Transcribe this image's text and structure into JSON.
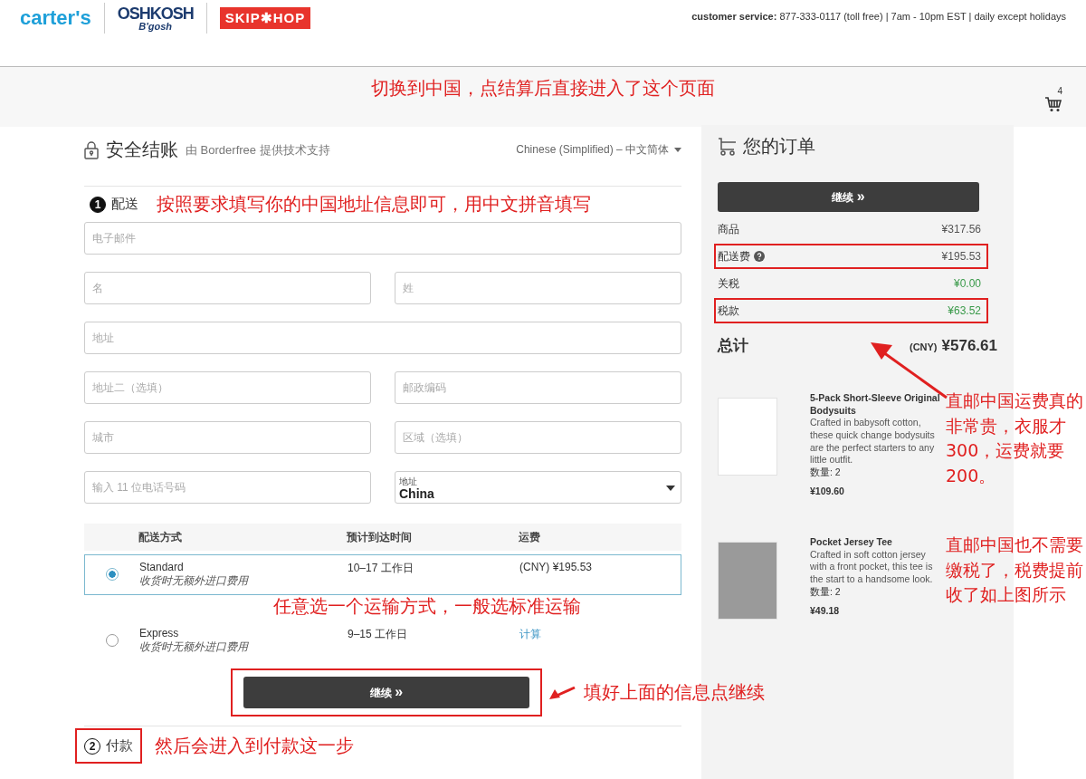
{
  "header": {
    "logos": [
      {
        "kind": "carters",
        "text": "carter's"
      },
      {
        "kind": "oshkosh",
        "text": "OSHKOSH",
        "sub": "B'gosh"
      },
      {
        "kind": "skiphop",
        "text": "SKIP✱HOP"
      }
    ],
    "service_label": "customer service:",
    "service_text": "877-333-0117 (toll free) | 7am - 10pm EST | daily except holidays"
  },
  "banner": {
    "note": "切换到中国，点结算后直接进入了这个页面",
    "cart_count": "4"
  },
  "checkout": {
    "title": "安全结账",
    "powered_by": "由 Borderfree 提供技术支持",
    "language": "Chinese (Simplified) – 中文简体"
  },
  "step_shipping": {
    "number": "1",
    "label": "配送",
    "active": true,
    "highlighted": false,
    "note": "按照要求填写你的中国地址信息即可，用中文拼音填写"
  },
  "fields": [
    {
      "kind": "full",
      "placeholder": "电子邮件"
    },
    {
      "kind": "half",
      "placeholder": "名"
    },
    {
      "kind": "half",
      "placeholder": "姓"
    },
    {
      "kind": "full",
      "placeholder": "地址"
    },
    {
      "kind": "half",
      "placeholder": "地址二（选填）"
    },
    {
      "kind": "half",
      "placeholder": "邮政编码"
    },
    {
      "kind": "half",
      "placeholder": "城市"
    },
    {
      "kind": "half",
      "placeholder": "区域（选填）"
    },
    {
      "kind": "half",
      "placeholder": "输入 11 位电话号码"
    },
    {
      "kind": "select",
      "label": "地址",
      "value": "China"
    }
  ],
  "shipping": {
    "columns": [
      "配送方式",
      "预计到达时间",
      "运费"
    ],
    "note": "任意选一个运输方式，一般选标准运输",
    "options": [
      {
        "name": "Standard",
        "remark": "收货时无额外进口费用",
        "time": "10–17 工作日",
        "currency": "(CNY)",
        "cost": "¥195.53",
        "selected": true
      },
      {
        "name": "Express",
        "remark": "收货时无额外进口费用",
        "time": "9–15 工作日",
        "link": "计算",
        "selected": false
      }
    ]
  },
  "continue": {
    "label": "继续",
    "chevron": "»",
    "highlighted": true,
    "note": "填好上面的信息点继续"
  },
  "step_payment": {
    "number": "2",
    "label": "付款",
    "active": false,
    "highlighted": true,
    "note": "然后会进入到付款这一步"
  },
  "order": {
    "title": "您的订单",
    "button": "继续",
    "chevron": "»",
    "lines": [
      {
        "label": "商品",
        "value": "¥317.56",
        "help": false,
        "highlighted": false,
        "color": "#555555"
      },
      {
        "label": "配送费",
        "value": "¥195.53",
        "help": true,
        "highlighted": true,
        "color": "#555555"
      },
      {
        "label": "关税",
        "value": "¥0.00",
        "help": false,
        "highlighted": false,
        "color": "#3a9a4a"
      },
      {
        "label": "税款",
        "value": "¥63.52",
        "help": false,
        "highlighted": true,
        "color": "#3a9a4a"
      }
    ],
    "total": {
      "label": "总计",
      "currency": "(CNY)",
      "value": "¥576.61"
    },
    "items": [
      {
        "kind": "bodysuit",
        "name": "5-Pack Short-Sleeve Original Bodysuits",
        "description": "Crafted in babysoft cotton, these quick change bodysuits are the perfect starters to any little outfit.",
        "quantity": "数量: 2",
        "price": "¥109.60",
        "note": "直邮中国运费真的非常贵，衣服才300，运费就要200。"
      },
      {
        "kind": "tee",
        "name": "Pocket Jersey Tee",
        "description": "Crafted in soft cotton jersey with a front pocket, this tee is the start to a handsome look.",
        "quantity": "数量: 2",
        "price": "¥49.18",
        "note": "直邮中国也不需要缴税了，税费提前收了如上图所示"
      }
    ]
  }
}
